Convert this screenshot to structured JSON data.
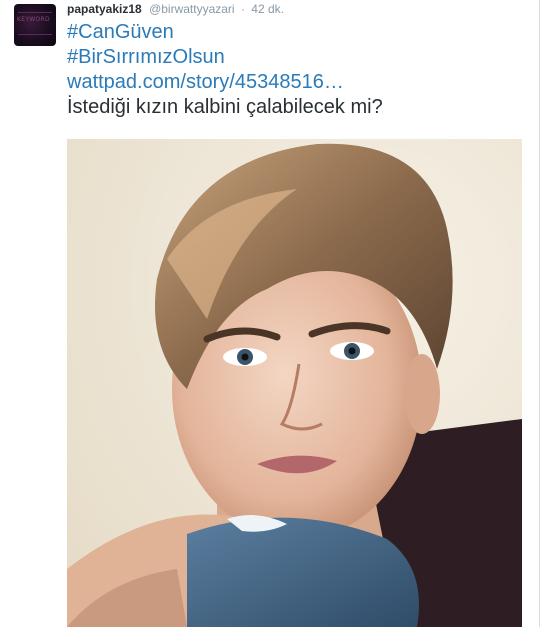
{
  "tweet": {
    "username": "papatyakiz18",
    "handle": "@birwattyyazari",
    "separator": "·",
    "time": "42 dk.",
    "hashtag_1": "#CanGüven",
    "hashtag_2": "#BirSırrımızOlsun",
    "link": "wattpad.com/story/45348516…",
    "text": "İstediği kızın kalbini çalabilecek mi?"
  },
  "avatar": {
    "icon": "book-cover-avatar",
    "text": "KEYWORD"
  },
  "colors": {
    "link": "#2b7bb9",
    "text": "#292f33",
    "muted": "#8899a6"
  }
}
